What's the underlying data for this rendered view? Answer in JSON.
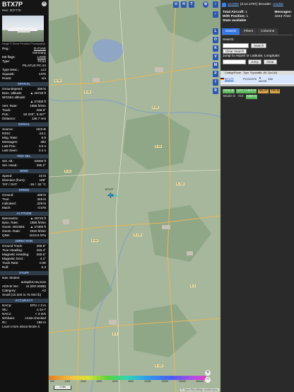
{
  "infoblock": {
    "callsign": "BTX7P",
    "hex_line": "Hex:  3CF775",
    "photo_credit": "Image © Sierra Peralbec Photography",
    "basic": [
      {
        "k": "Reg.:",
        "v": "D-CVAE",
        "link": true
      },
      {
        "k": "",
        "v": "Germany"
      },
      {
        "k": "DB flags:",
        "v": "LADD",
        "link": true
      },
      {
        "k": "Type:",
        "v": "PC24"
      },
      {
        "k": "",
        "v": "PILATUS PC-24"
      },
      {
        "k": "Type Desc.:",
        "v": "L2J"
      },
      {
        "k": "Squawk:",
        "v": "1376"
      },
      {
        "k": "Route:",
        "v": "n/a"
      }
    ],
    "sections": [
      {
        "title": "SPATIAL",
        "rows": [
          {
            "k": "Groundspeed:",
            "v": "338 kt"
          },
          {
            "k": "Baro. altitude:",
            "v": "▲ 26725 ft"
          },
          {
            "k": "WGS84 altitude:",
            "v": ""
          },
          {
            "k": "",
            "v": "▲ 27300 ft"
          },
          {
            "k": "Vert. Rate:",
            "v": "1856 ft/min"
          },
          {
            "k": "Track:",
            "v": "266.8°"
          },
          {
            "k": "Pos.:",
            "v": "52.233°, 9.347°"
          },
          {
            "k": "Distance:",
            "v": "136.7 nmi"
          }
        ]
      },
      {
        "title": "SIGNAL",
        "rows": [
          {
            "k": "Source:",
            "v": "ADS-B"
          },
          {
            "k": "RSSI:",
            "v": "-24.1"
          },
          {
            "k": "Msg. Rate:",
            "v": "6.5"
          },
          {
            "k": "Messages:",
            "v": "282"
          },
          {
            "k": "Last Pos.:",
            "v": "3.6 s"
          },
          {
            "k": "Last Seen:",
            "v": "0.4 s"
          }
        ]
      },
      {
        "title": "FMS SEL",
        "rows": [
          {
            "k": "Sel. Alt.:",
            "v": "34000 ft"
          },
          {
            "k": "Sel. Head.:",
            "v": "260.2°"
          }
        ]
      },
      {
        "title": "WIND",
        "rows": [
          {
            "k": "Speed:",
            "v": "22 kt"
          },
          {
            "k": "Direction (from):",
            "v": "198°"
          },
          {
            "k": "TAT / OAT:",
            "v": "-16 / -32 °C"
          }
        ]
      },
      {
        "title": "SPEED",
        "rows": [
          {
            "k": "Ground:",
            "v": "338 kt"
          },
          {
            "k": "True:",
            "v": "346 kt"
          },
          {
            "k": "Indicated:",
            "v": "229 kt"
          },
          {
            "k": "Mach:",
            "v": "0.576"
          }
        ]
      },
      {
        "title": "ALTITUDE",
        "rows": [
          {
            "k": "Barometric:",
            "v": "▲ 26725 ft"
          },
          {
            "k": "Baro. Rate:",
            "v": "1856 ft/min"
          },
          {
            "k": "Geom. WGS84:",
            "v": "▲ 27300 ft"
          },
          {
            "k": "Geom. Rate:",
            "v": "2016 ft/min"
          },
          {
            "k": "QNH:",
            "v": "1013.6 hPa"
          }
        ]
      },
      {
        "title": "DIRECTION",
        "rows": [
          {
            "k": "Ground Track:",
            "v": "266.8°"
          },
          {
            "k": "True Heading:",
            "v": "263.4°"
          },
          {
            "k": "Magnetic Heading:",
            "v": "259.5°"
          },
          {
            "k": "Magnetic Decl.:",
            "v": "4.1°"
          },
          {
            "k": "Track Rate:",
            "v": "0.00"
          },
          {
            "k": "Roll:",
            "v": "0.3"
          }
        ]
      },
      {
        "title": "STUFF",
        "rows": [
          {
            "k": "Nav. Modes:",
            "v": ""
          },
          {
            "k": "",
            "v": "autopilot,nav,tcas"
          },
          {
            "k": "ADS-B Ver.:",
            "v": "v2 (DO-260B)"
          },
          {
            "k": "Category:",
            "v": "A2"
          }
        ],
        "text": "Small (15 500 to 75 000 lb)"
      },
      {
        "title": "ACCURACY",
        "rows": [
          {
            "k": "NACp:",
            "v": "EPU < 3 m"
          },
          {
            "k": "SIL:",
            "v": "≤ 1e-7"
          },
          {
            "k": "NACv:",
            "v": "< 3 m/s"
          },
          {
            "k": "NICbaro:",
            "v": "cross-checked"
          },
          {
            "k": "Rc:",
            "v": "186 m"
          }
        ],
        "text": "Learn more about Mode S"
      }
    ]
  },
  "map": {
    "buttons_top": [
      "U",
      "H",
      "T"
    ],
    "buttons_side": [
      "L",
      "O",
      "K",
      "V",
      "M",
      "P",
      "I",
      "R"
    ],
    "labels": [
      {
        "text": "B 65"
      },
      {
        "text": "B 65"
      },
      {
        "text": "B 83"
      },
      {
        "text": "B 83"
      },
      {
        "text": "B 64"
      },
      {
        "text": "B 240"
      },
      {
        "text": "B 240"
      },
      {
        "text": "B 64"
      },
      {
        "text": "B 3"
      },
      {
        "text": "B 6"
      },
      {
        "text": "B 443"
      }
    ],
    "aircraft_label": "BTX7P",
    "colorbar_labels": [
      "500",
      "1000",
      "2000",
      "4000",
      "6000",
      "8000",
      "10000",
      "20000",
      "30000",
      "40000+"
    ],
    "scale": "2 NM",
    "zoom_in": "+",
    "zoom_out": "−",
    "attribution": "© OpenStreetMap contributors."
  },
  "sidebar": {
    "version_link": "wr1090",
    "version_text": "(3.14.1787) decoder:",
    "readsb_link": "readsb",
    "stats": {
      "total_label": "Total Aircraft:",
      "total_value": "1",
      "with_pos_label": "With Position:",
      "with_pos_value": "1",
      "stats_label": "Stats available",
      "messages_label": "Messages:",
      "messages_value": "1643.7/sec"
    },
    "tabs": [
      "Search",
      "Filters",
      "Columns"
    ],
    "search": {
      "label": "Search:",
      "search_btn": "Search",
      "clear_btn": "Clear Search",
      "jump_label": "Jump to Airport or Latitude, Longitude:",
      "jump_btn": "Jump",
      "jump_clear": "Clear"
    },
    "table": {
      "headers": [
        "",
        "Callsign",
        "Route",
        "Type",
        "Squawk",
        "Alt. (ft)",
        "Spd (kt)",
        ""
      ],
      "row": {
        "callsign": "BTX7P",
        "type": "PC24",
        "squawk": "1376",
        "alt": "▲ 26725",
        "spd": "338"
      }
    },
    "badges": [
      {
        "text": "ADS-B",
        "style": "green"
      },
      {
        "text": "UAT / ADS-R",
        "style": "green"
      },
      {
        "text": "MLAT",
        "style": "amber"
      },
      {
        "text": "TIS-B",
        "style": "amber"
      },
      {
        "text": "Mode-S",
        "style": "plain"
      },
      {
        "text": "AIS",
        "style": "plain"
      },
      {
        "text": "ADS-C",
        "style": "green"
      }
    ]
  }
}
